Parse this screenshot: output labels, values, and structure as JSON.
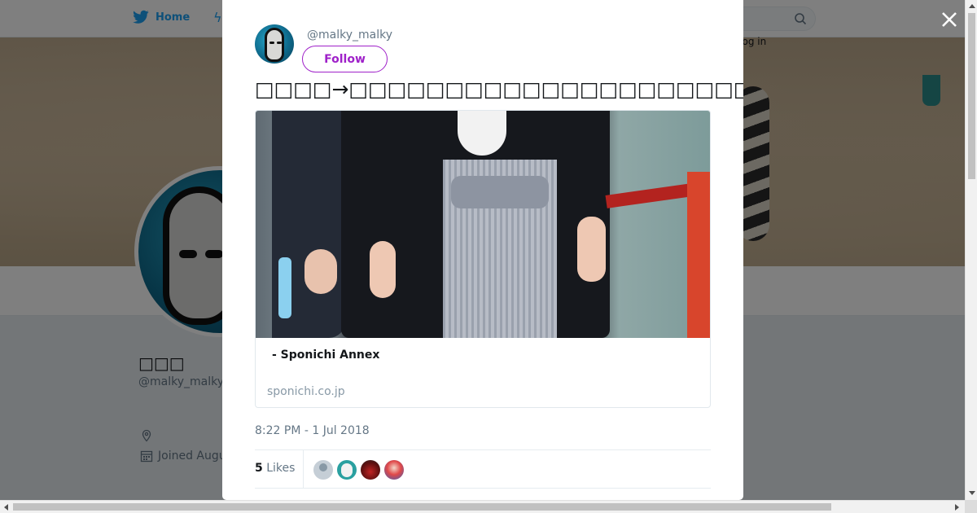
{
  "background": {
    "nav": {
      "home_label": "Home",
      "login_label": "Log in"
    },
    "profile": {
      "name": "□□□",
      "handle": "@malky_malky",
      "joined": "Joined Augu"
    }
  },
  "tweet": {
    "author_handle": "@malky_malky",
    "follow_label": "Follow",
    "text": "□□□□→□□□□□□□□□□□□□□□□□□□□□□□□□□□□□□□□□□□□□□□□□□ — □□□□ Sponichi Annex",
    "card": {
      "title": "-  Sponichi Annex",
      "domain": "sponichi.co.jp"
    },
    "timestamp": "8:22 PM - 1 Jul 2018",
    "likes_count": "5",
    "likes_label": "Likes"
  },
  "colors": {
    "accent": "#9f21c9",
    "twitter_blue": "#1da1f2",
    "muted_text": "#657786"
  },
  "icons": [
    "twitter-bird-icon",
    "bolt-icon",
    "search-icon",
    "location-icon",
    "calendar-icon",
    "close-icon"
  ]
}
